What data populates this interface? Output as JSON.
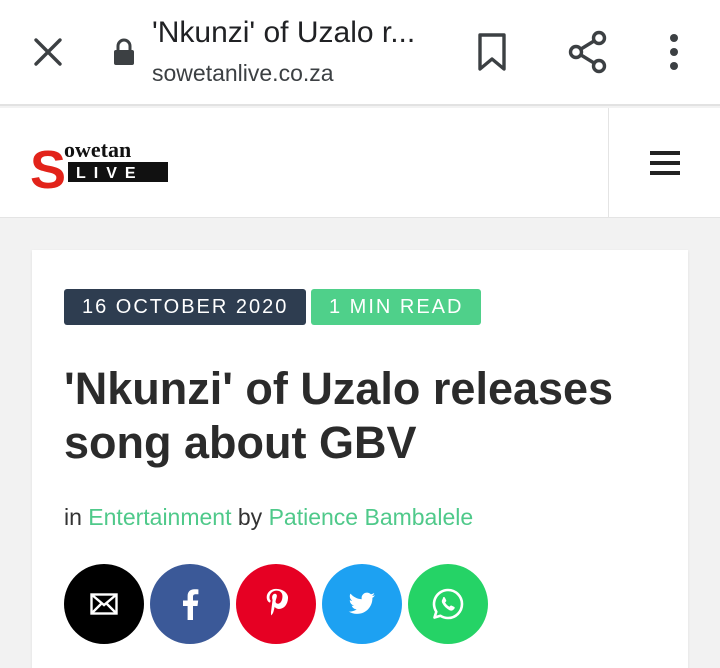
{
  "browser": {
    "page_title": "'Nkunzi' of Uzalo r...",
    "domain": "sowetanlive.co.za"
  },
  "site": {
    "logo_word": "owetan",
    "logo_letter": "S",
    "logo_sub": "LIVE"
  },
  "article": {
    "date": "16 OCTOBER 2020",
    "read_time": "1 MIN READ",
    "headline": "'Nkunzi' of Uzalo releases song about GBV",
    "meta_in": "in ",
    "category": "Entertainment",
    "meta_by": " by ",
    "author": "Patience Bambalele"
  },
  "share_buttons": [
    {
      "icon": "email-icon",
      "color": "#000000"
    },
    {
      "icon": "facebook-icon",
      "color": "#3b5998"
    },
    {
      "icon": "pinterest-icon",
      "color": "#e60023"
    },
    {
      "icon": "twitter-icon",
      "color": "#1da1f2"
    },
    {
      "icon": "whatsapp-icon",
      "color": "#25d366"
    }
  ],
  "colors": {
    "accent_green": "#4fd08a",
    "badge_navy": "#2e3d50",
    "brand_red": "#e2231a"
  }
}
